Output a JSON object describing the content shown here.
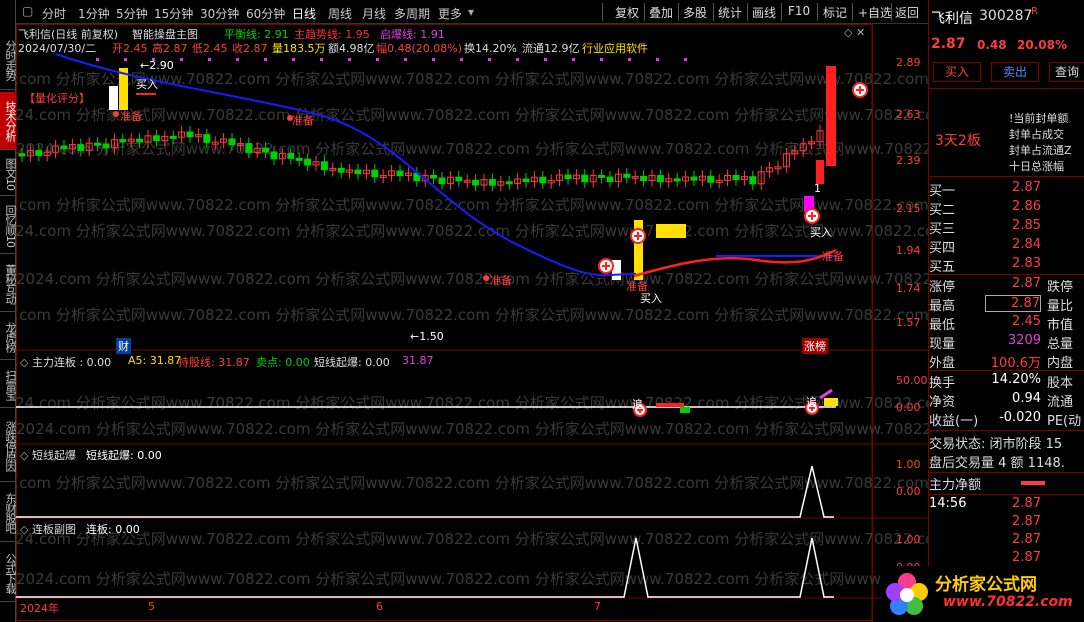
{
  "left_tabs": [
    "分时走势",
    "技术分析",
    "图文10",
    "回忆顺10",
    "董秘互动",
    "龙虎榜",
    "扫雷宝",
    "涨跌停原因",
    "东财股吧",
    "公式下载"
  ],
  "timeframes": [
    "分时",
    "1分钟",
    "5分钟",
    "15分钟",
    "30分钟",
    "60分钟",
    "日线",
    "周线",
    "月线",
    "多周期",
    "更多"
  ],
  "more_arrow": "▾",
  "toolbar": [
    "复权",
    "叠加",
    "多股",
    "统计",
    "画线",
    "F10",
    "标记",
    "+自选",
    "返回"
  ],
  "info": {
    "stock_line": "飞利信(日线 前复权)",
    "formula": "智能操盘主图",
    "balance": "平衡线: 2.91",
    "trend": "主趋势线: 1.95",
    "burst": "启爆线: 1.91",
    "date": "2024/07/30/二",
    "open": "开2.45",
    "high": "高2.87",
    "low": "低2.45",
    "close": "收2.87",
    "vol": "量183.5万",
    "amount": "额4.98亿",
    "change": "幅0.48(20.08%)",
    "turnover": "换14.20%",
    "float": "流通12.9亿",
    "industry": "行业应用软件"
  },
  "markers": {
    "score": "【量化评分】",
    "prepare": "准备",
    "buy": "买入",
    "chase": "追",
    "high_label": "2.90",
    "low_label": "1.50",
    "cai": "财",
    "zhangbang": "涨榜",
    "one": "1"
  },
  "price_axis": [
    "2.89",
    "2.63",
    "2.39",
    "2.15",
    "1.94",
    "1.74",
    "1.57"
  ],
  "date_axis": [
    "2024年",
    "5",
    "6",
    "7"
  ],
  "watermark": "2024.com 分析家公式网www.70822.com 分析家公式网www.70822.com 分析家公式网www.70822.com 分析家公式网www.70822.com",
  "panel1": {
    "title": "主力连板 : 0.00",
    "a5": "A5: 31.87",
    "hold": "持股线: 31.87",
    "sell": "卖点: 0.00",
    "short": "短线起爆: 0.00",
    "val": "31.87",
    "axis": [
      "50.00",
      "0.00"
    ]
  },
  "panel2": {
    "title": "短线起爆",
    "label": "短线起爆: 0.00",
    "axis": [
      "1.00",
      "0.00"
    ]
  },
  "panel3": {
    "title": "连板副图",
    "label": "连板: 0.00",
    "axis": [
      "1.00",
      "0.00"
    ]
  },
  "right": {
    "name": "飞利信",
    "code": "300287",
    "flag": "R",
    "price": "2.87",
    "chg": "0.48",
    "pct": "20.08%",
    "buy_btn": "买入",
    "sell_btn": "卖出",
    "query_btn": "查询",
    "board": "3天2板",
    "seal_rows": [
      "!当前封单额",
      "封单占成交",
      "封单占流通Z",
      "十日总涨幅"
    ],
    "bids": [
      {
        "l": "买一",
        "v": "2.87"
      },
      {
        "l": "买二",
        "v": "2.86"
      },
      {
        "l": "买三",
        "v": "2.85"
      },
      {
        "l": "买四",
        "v": "2.84"
      },
      {
        "l": "买五",
        "v": "2.83"
      }
    ],
    "stats": [
      {
        "l": "涨停",
        "v": "2.87",
        "r": "跌停"
      },
      {
        "l": "最高",
        "v": "2.87",
        "r": "量比"
      },
      {
        "l": "最低",
        "v": "2.45",
        "r": "市值"
      },
      {
        "l": "现量",
        "v": "3209",
        "r": "总量"
      },
      {
        "l": "外盘",
        "v": "100.6万",
        "r": "内盘"
      }
    ],
    "stats2": [
      {
        "l": "换手",
        "v": "14.20%",
        "r": "股本"
      },
      {
        "l": "净资",
        "v": "0.94",
        "r": "流通"
      },
      {
        "l": "收益(一)",
        "v": "-0.020",
        "r": "PE(动"
      }
    ],
    "trade_state": "交易状态: 闭市阶段 15",
    "after": "盘后交易量 4 额 1148.",
    "net": "主力净额",
    "ticks": [
      {
        "t": "14:56",
        "v": "2.87"
      },
      {
        "t": "",
        "v": "2.87"
      },
      {
        "t": "",
        "v": "2.87"
      },
      {
        "t": "",
        "v": "2.87"
      }
    ],
    "logo_cn": "分析家公式网",
    "logo_url": "www.70822.com"
  },
  "colors": {
    "up": "#ff3c3c",
    "down": "#00d000",
    "ma": "#1a1aff",
    "bg": "#000000",
    "grid": "#7a0000"
  }
}
